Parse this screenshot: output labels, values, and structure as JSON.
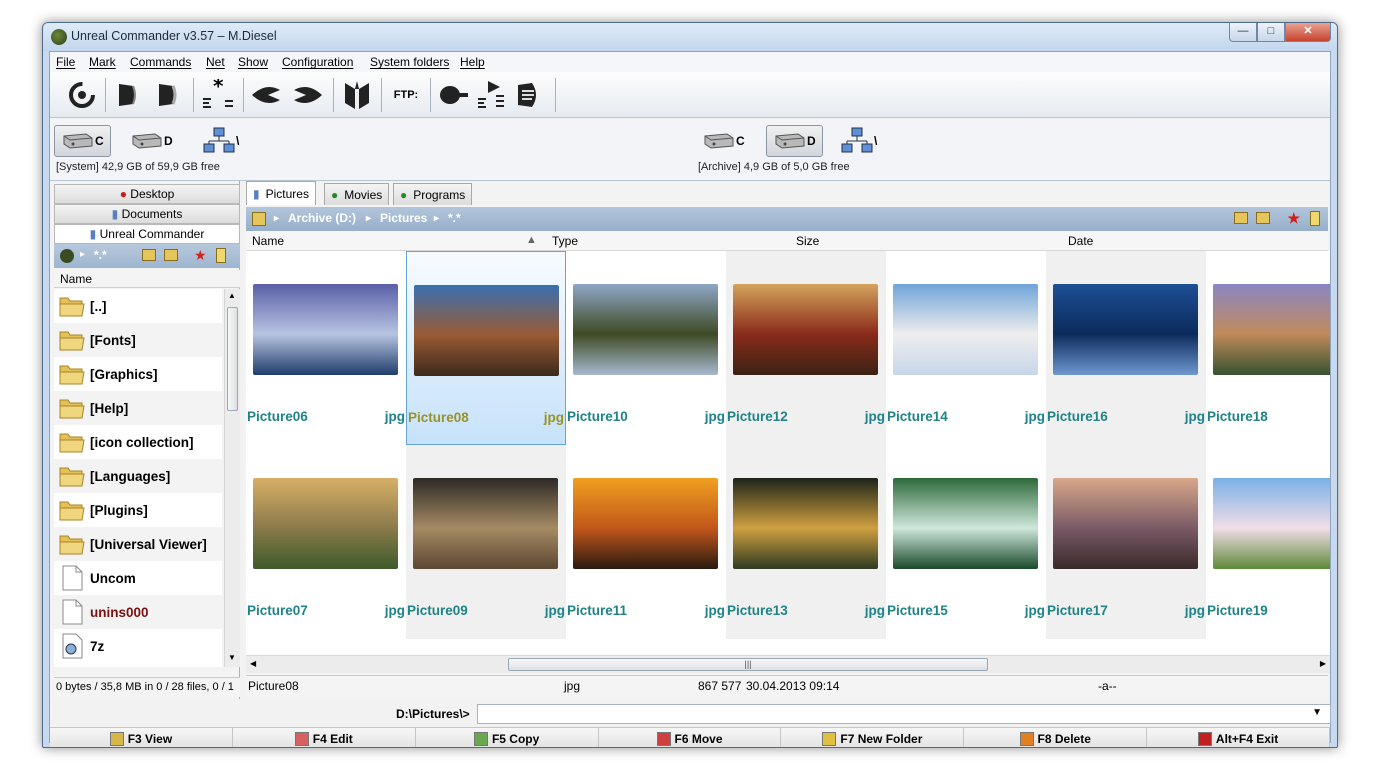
{
  "window": {
    "title": "Unreal Commander v3.57 – M.Diesel",
    "controls": {
      "minimize": "—",
      "maximize": "□",
      "close": "✕"
    }
  },
  "menu": [
    {
      "label": "File"
    },
    {
      "label": "Mark"
    },
    {
      "label": "Commands"
    },
    {
      "label": "Net"
    },
    {
      "label": "Show"
    },
    {
      "label": "Configuration"
    },
    {
      "label": "System folders"
    },
    {
      "label": "Help"
    }
  ],
  "toolbar": {
    "ftp_label": "FTP:",
    "icons": [
      "refresh-icon",
      "left-panel-icon",
      "right-panel-icon",
      "select-all-icon",
      "view-left-icon",
      "view-right-icon",
      "archive-icon",
      "ftp-connect-icon",
      "ftp-list-icon",
      "ftp-disconnect-icon"
    ]
  },
  "drives": {
    "left": {
      "items": [
        "C",
        "D",
        "\\"
      ],
      "active": "C",
      "info": "[System]  42,9 GB of  59,9 GB free"
    },
    "right": {
      "items": [
        "C",
        "D",
        "\\"
      ],
      "active": "D",
      "info": "[Archive]  4,9 GB of  5,0 GB free"
    }
  },
  "left_panel": {
    "tabs": [
      {
        "label": "Desktop",
        "icon": "lock-icon"
      },
      {
        "label": "Documents",
        "icon": "folder-icon"
      },
      {
        "label": "Unreal Commander",
        "icon": "folder-icon"
      }
    ],
    "path_glob": "*.*",
    "column": "Name",
    "items": [
      {
        "name": "[..]",
        "kind": "up",
        "color": "#000000"
      },
      {
        "name": "[Fonts]",
        "kind": "folder",
        "color": "#000000"
      },
      {
        "name": "[Graphics]",
        "kind": "folder",
        "color": "#000000"
      },
      {
        "name": "[Help]",
        "kind": "folder",
        "color": "#000000"
      },
      {
        "name": "[icon collection]",
        "kind": "folder",
        "color": "#000000"
      },
      {
        "name": "[Languages]",
        "kind": "folder",
        "color": "#000000"
      },
      {
        "name": "[Plugins]",
        "kind": "folder",
        "color": "#000000"
      },
      {
        "name": "[Universal Viewer]",
        "kind": "folder",
        "color": "#000000"
      },
      {
        "name": "Uncom",
        "kind": "file",
        "color": "#000000"
      },
      {
        "name": "unins000",
        "kind": "file",
        "color": "#7a1010"
      },
      {
        "name": "7z",
        "kind": "lib",
        "color": "#000000"
      }
    ],
    "status": "0 bytes / 35,8 MB in 0 / 28 files, 0 / 1"
  },
  "right_panel": {
    "tabs": [
      {
        "label": "Pictures",
        "icon": "folder-icon",
        "active": true
      },
      {
        "label": "Movies",
        "icon": "lock-icon",
        "active": false
      },
      {
        "label": "Programs",
        "icon": "lock-icon",
        "active": false
      }
    ],
    "path": {
      "drive": "Archive (D:)",
      "folder": "Pictures",
      "glob": "*.*"
    },
    "columns": {
      "name": "Name",
      "type": "Type",
      "size": "Size",
      "date": "Date"
    },
    "thumbnails": [
      {
        "name": "Picture06",
        "ext": "jpg",
        "palette": [
          "#5a5fa8",
          "#b7c4e0",
          "#1f3d6b"
        ]
      },
      {
        "name": "Picture08",
        "ext": "jpg",
        "palette": [
          "#3a6fb0",
          "#9a5a34",
          "#3b2a1c"
        ]
      },
      {
        "name": "Picture10",
        "ext": "jpg",
        "palette": [
          "#8fa7c6",
          "#3e4a24",
          "#a7b9cf"
        ]
      },
      {
        "name": "Picture12",
        "ext": "jpg",
        "palette": [
          "#d4a35c",
          "#8a2b1a",
          "#3b2214"
        ]
      },
      {
        "name": "Picture14",
        "ext": "jpg",
        "palette": [
          "#6fa3d8",
          "#eeeeee",
          "#c7d6e8"
        ]
      },
      {
        "name": "Picture16",
        "ext": "jpg",
        "palette": [
          "#1d4f96",
          "#0c2b5c",
          "#6e98d0"
        ]
      },
      {
        "name": "Picture18",
        "ext": "jpg",
        "palette": [
          "#8a86c4",
          "#c08a5a",
          "#355230"
        ]
      },
      {
        "name": "Picture07",
        "ext": "jpg",
        "palette": [
          "#d7b067",
          "#8a7a4a",
          "#3e5a2a"
        ]
      },
      {
        "name": "Picture09",
        "ext": "jpg",
        "palette": [
          "#2e2a26",
          "#a58a63",
          "#5c4733"
        ]
      },
      {
        "name": "Picture11",
        "ext": "jpg",
        "palette": [
          "#f0a020",
          "#c2571a",
          "#2a1a10"
        ]
      },
      {
        "name": "Picture13",
        "ext": "jpg",
        "palette": [
          "#1c2418",
          "#d0a040",
          "#2e3a22"
        ]
      },
      {
        "name": "Picture15",
        "ext": "jpg",
        "palette": [
          "#2e6a3a",
          "#cfe7dc",
          "#1a4a2a"
        ]
      },
      {
        "name": "Picture17",
        "ext": "jpg",
        "palette": [
          "#d8a88a",
          "#7a5a66",
          "#3a2a2a"
        ]
      },
      {
        "name": "Picture19",
        "ext": "jpg",
        "palette": [
          "#7ab0e8",
          "#f2dde6",
          "#5d8a3a"
        ]
      }
    ],
    "selected": "Picture08",
    "status": {
      "name": "Picture08",
      "type": "jpg",
      "size": "867 577",
      "date": "30.04.2013 09:14",
      "attr": "-a--"
    }
  },
  "command_line": {
    "prompt": "D:\\Pictures\\>",
    "value": ""
  },
  "fkeys": [
    {
      "label": "F3 View",
      "icon": "view-icon",
      "color": "#d6b84a"
    },
    {
      "label": "F4 Edit",
      "icon": "edit-icon",
      "color": "#d86060"
    },
    {
      "label": "F5 Copy",
      "icon": "copy-icon",
      "color": "#6aa84f"
    },
    {
      "label": "F6 Move",
      "icon": "move-icon",
      "color": "#d04040"
    },
    {
      "label": "F7 New Folder",
      "icon": "new-folder-icon",
      "color": "#e0c040"
    },
    {
      "label": "F8 Delete",
      "icon": "delete-icon",
      "color": "#e08020"
    },
    {
      "label": "Alt+F4 Exit",
      "icon": "exit-icon",
      "color": "#c02020"
    }
  ]
}
